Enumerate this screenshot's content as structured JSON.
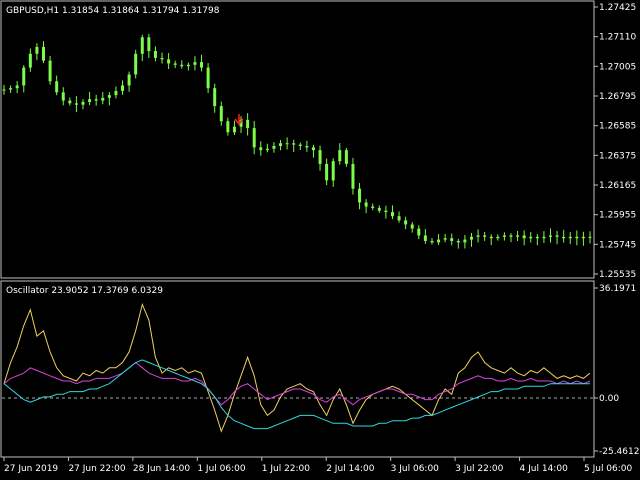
{
  "main": {
    "header": "GBPUSD,H1  1.31854 1.31864 1.31794 1.31798",
    "price_ticks": [
      "1.27425",
      "1.27110",
      "1.27005",
      "1.26795",
      "1.26585",
      "1.26375",
      "1.26165",
      "1.25955",
      "1.25745",
      "1.25535"
    ],
    "candle_color": "#7CFC4A",
    "signal_arrow": {
      "icon": "down-arrow-icon",
      "color": "#ff2020"
    }
  },
  "oscillator": {
    "header": "Oscillator 23.9052 17.3769 6.0329",
    "ticks": {
      "max": "36.1971",
      "zero": "0.00",
      "min": "-25.4612"
    },
    "line_colors": {
      "yellow": "#f0d060",
      "magenta": "#e040e0",
      "cyan": "#30d8e0"
    }
  },
  "time_axis": [
    "27 Jun 2019",
    "27 Jun 22:00",
    "28 Jun 14:00",
    "1 Jul 06:00",
    "1 Jul 22:00",
    "2 Jul 14:00",
    "3 Jul 06:00",
    "3 Jul 22:00",
    "4 Jul 14:00",
    "5 Jul 06:00"
  ],
  "chart_data": [
    {
      "type": "candlestick",
      "title": "GBPUSD,H1",
      "ohlc_last": [
        1.31854,
        1.31864,
        1.31794,
        1.31798
      ],
      "ylim": [
        1.255,
        1.2744
      ],
      "close_series": [
        1.2684,
        1.2685,
        1.2687,
        1.27,
        1.271,
        1.2715,
        1.2705,
        1.269,
        1.2682,
        1.2676,
        1.2674,
        1.2673,
        1.2675,
        1.2677,
        1.2676,
        1.2678,
        1.268,
        1.2683,
        1.2687,
        1.2695,
        1.271,
        1.2722,
        1.2712,
        1.2707,
        1.2706,
        1.2703,
        1.2702,
        1.2701,
        1.2702,
        1.2704,
        1.27,
        1.2685,
        1.2672,
        1.2661,
        1.2653,
        1.2657,
        1.2662,
        1.2656,
        1.2642,
        1.264,
        1.2641,
        1.2643,
        1.2645,
        1.2645,
        1.2644,
        1.2643,
        1.2642,
        1.264,
        1.263,
        1.2618,
        1.2632,
        1.264,
        1.263,
        1.2612,
        1.2602,
        1.2599,
        1.2598,
        1.2596,
        1.2595,
        1.2592,
        1.2589,
        1.2586,
        1.2583,
        1.2578,
        1.2574,
        1.2573,
        1.2575,
        1.2576,
        1.2574,
        1.2573,
        1.2575,
        1.2577,
        1.2578,
        1.2577,
        1.2576,
        1.2577,
        1.2578,
        1.2577,
        1.2578,
        1.2576,
        1.2577,
        1.2576,
        1.2577,
        1.2578,
        1.2577,
        1.2576,
        1.2577,
        1.2576,
        1.2577,
        1.2577
      ]
    },
    {
      "type": "line",
      "title": "Oscillator",
      "ylim": [
        -25.4612,
        36.1971
      ],
      "series": [
        {
          "color": "#f0d060",
          "values": [
            0,
            8,
            14,
            22,
            28,
            18,
            20,
            12,
            6,
            3,
            2,
            1,
            4,
            3,
            5,
            4,
            6,
            6,
            8,
            12,
            20,
            30,
            24,
            10,
            4,
            6,
            5,
            6,
            4,
            5,
            4,
            -3,
            -10,
            -18,
            -12,
            -4,
            3,
            10,
            3,
            -8,
            -12,
            -10,
            -5,
            -2,
            -1,
            0,
            -2,
            -3,
            -8,
            -12,
            -6,
            -2,
            -8,
            -15,
            -10,
            -6,
            -4,
            -3,
            -2,
            -1,
            -2,
            -4,
            -6,
            -8,
            -10,
            -12,
            -6,
            -2,
            -4,
            4,
            6,
            10,
            12,
            8,
            6,
            5,
            4,
            6,
            4,
            3,
            5,
            4,
            6,
            4,
            2,
            3,
            2,
            3,
            2,
            4
          ]
        },
        {
          "color": "#e040e0",
          "values": [
            0,
            2,
            3,
            4,
            6,
            5,
            4,
            3,
            2,
            1,
            1,
            0,
            1,
            1,
            2,
            2,
            2,
            3,
            4,
            6,
            8,
            6,
            4,
            3,
            2,
            2,
            2,
            1,
            1,
            2,
            1,
            -2,
            -5,
            -8,
            -6,
            -3,
            -1,
            0,
            -2,
            -4,
            -6,
            -5,
            -4,
            -3,
            -2,
            -2,
            -3,
            -4,
            -6,
            -7,
            -5,
            -4,
            -6,
            -8,
            -6,
            -5,
            -4,
            -3,
            -2,
            -2,
            -3,
            -4,
            -4,
            -5,
            -6,
            -6,
            -4,
            -3,
            -2,
            0,
            1,
            2,
            3,
            2,
            2,
            1,
            1,
            2,
            1,
            1,
            2,
            1,
            1,
            1,
            0,
            1,
            0,
            1,
            0,
            1
          ]
        },
        {
          "color": "#30d8e0",
          "values": [
            0,
            -2,
            -4,
            -6,
            -7,
            -6,
            -5,
            -5,
            -4,
            -4,
            -3,
            -3,
            -3,
            -2,
            -2,
            -1,
            0,
            2,
            4,
            6,
            8,
            9,
            8,
            7,
            6,
            5,
            4,
            3,
            2,
            1,
            0,
            -2,
            -5,
            -9,
            -12,
            -14,
            -15,
            -16,
            -17,
            -17,
            -17,
            -16,
            -15,
            -14,
            -13,
            -12,
            -12,
            -12,
            -13,
            -14,
            -15,
            -15,
            -15,
            -16,
            -16,
            -16,
            -16,
            -15,
            -15,
            -14,
            -14,
            -14,
            -13,
            -13,
            -12,
            -12,
            -11,
            -10,
            -9,
            -8,
            -7,
            -6,
            -5,
            -4,
            -3,
            -3,
            -2,
            -2,
            -2,
            -1,
            -1,
            -1,
            -1,
            0,
            0,
            0,
            0,
            0,
            0,
            0
          ]
        }
      ]
    }
  ]
}
